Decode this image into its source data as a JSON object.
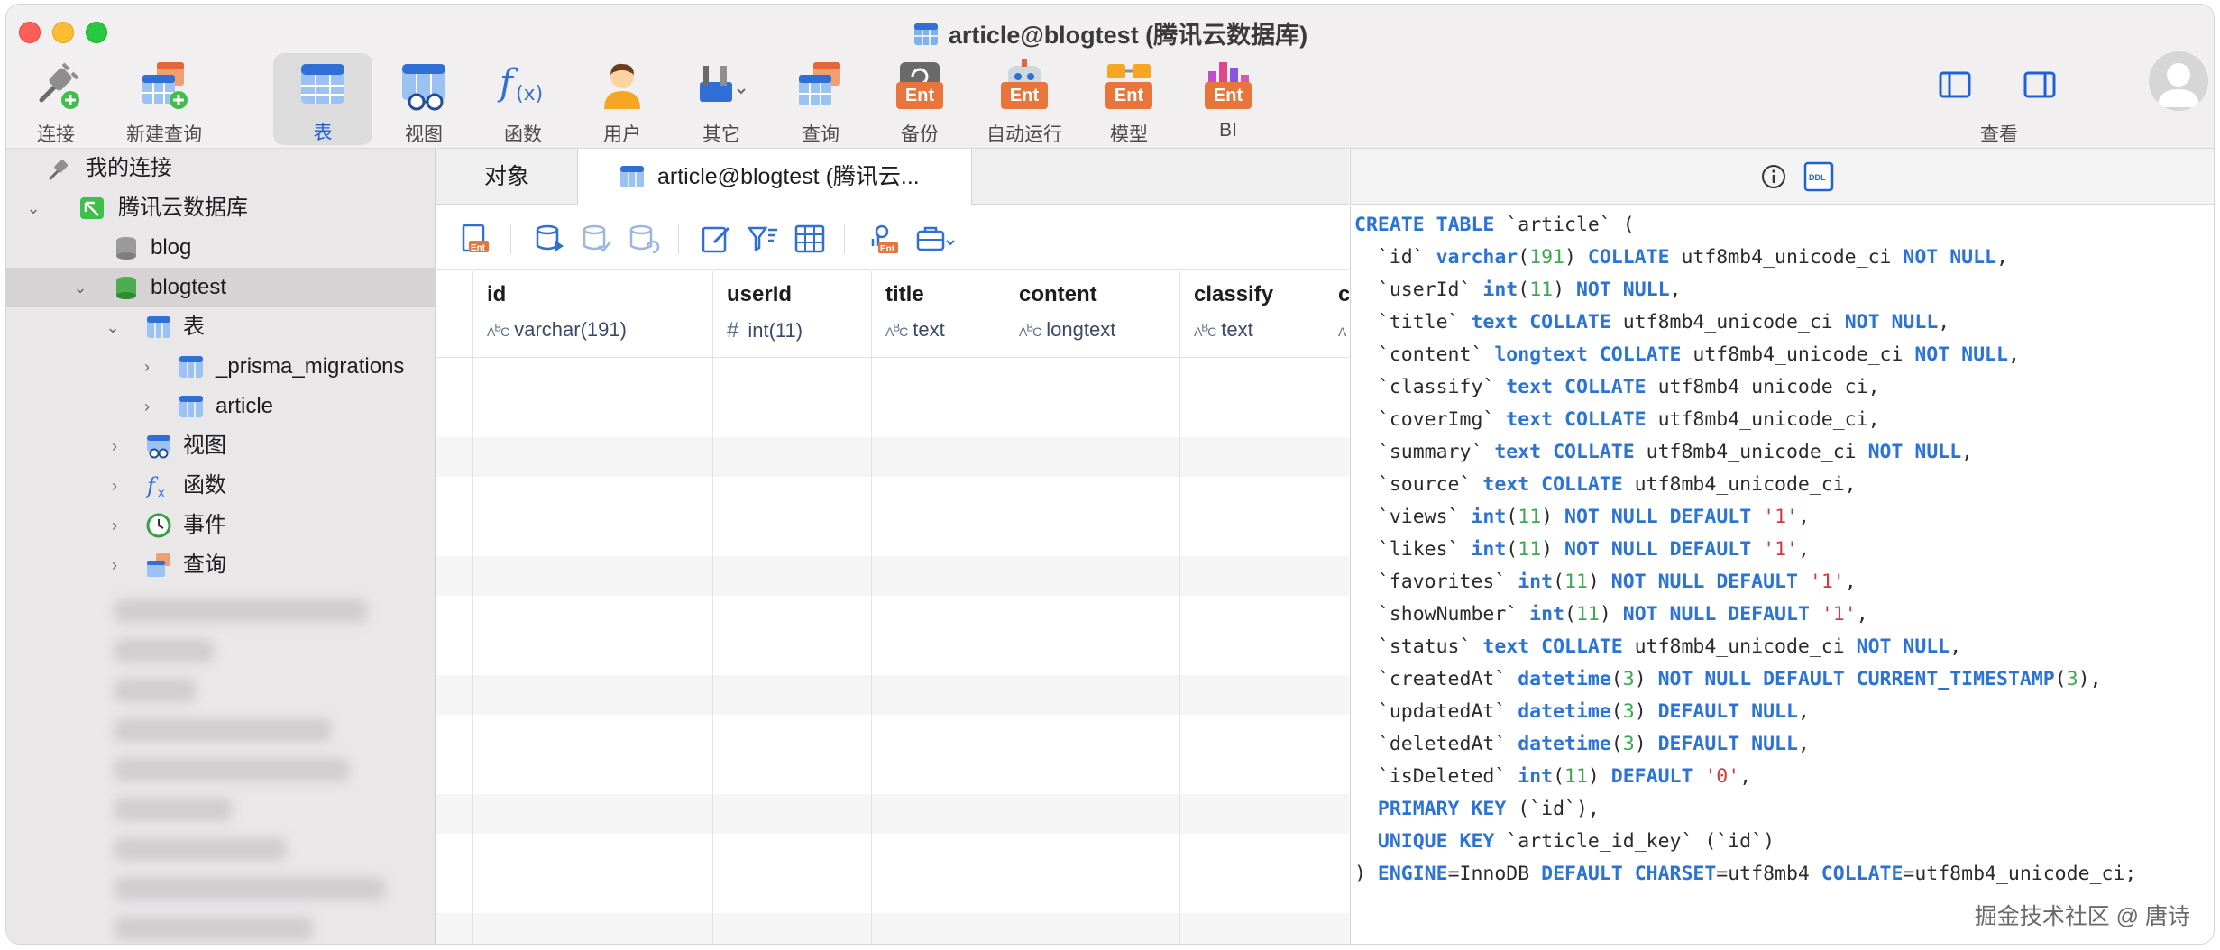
{
  "window": {
    "title": "article@blogtest (腾讯云数据库)"
  },
  "toolbar": {
    "buttons": [
      {
        "label": "连接",
        "icon": "plug-add-icon"
      },
      {
        "label": "新建查询",
        "icon": "new-query-icon"
      },
      {
        "label": "表",
        "icon": "table-icon",
        "active": true
      },
      {
        "label": "视图",
        "icon": "view-icon"
      },
      {
        "label": "函数",
        "icon": "function-icon"
      },
      {
        "label": "用户",
        "icon": "user-icon"
      },
      {
        "label": "其它",
        "icon": "tools-icon"
      },
      {
        "label": "查询",
        "icon": "query-icon"
      },
      {
        "label": "备份",
        "icon": "backup-icon",
        "badge": "Ent"
      },
      {
        "label": "自动运行",
        "icon": "robot-icon",
        "badge": "Ent"
      },
      {
        "label": "模型",
        "icon": "model-icon",
        "badge": "Ent"
      },
      {
        "label": "BI",
        "icon": "bi-icon",
        "badge": "Ent"
      }
    ],
    "view_label": "查看"
  },
  "sidebar": {
    "my_connections": "我的连接",
    "connection": "腾讯云数据库",
    "db_blog": "blog",
    "db_blogtest": "blogtest",
    "tables_group": "表",
    "table_1": "_prisma_migrations",
    "table_2": "article",
    "views": "视图",
    "functions": "函数",
    "events": "事件",
    "queries": "查询"
  },
  "tabs": {
    "objects": "对象",
    "active": "article@blogtest (腾讯云..."
  },
  "grid": {
    "columns": [
      {
        "name": "id",
        "type": "varchar(191)",
        "type_icon": "abc"
      },
      {
        "name": "userId",
        "type": "int(11)",
        "type_icon": "#"
      },
      {
        "name": "title",
        "type": "text",
        "type_icon": "abc"
      },
      {
        "name": "content",
        "type": "longtext",
        "type_icon": "abc"
      },
      {
        "name": "classify",
        "type": "text",
        "type_icon": "abc"
      },
      {
        "name": "c",
        "type": "",
        "type_icon": "abc"
      }
    ]
  },
  "ddl": {
    "lines": [
      "CREATE TABLE `article` (",
      "  `id` varchar(191) COLLATE utf8mb4_unicode_ci NOT NULL,",
      "  `userId` int(11) NOT NULL,",
      "  `title` text COLLATE utf8mb4_unicode_ci NOT NULL,",
      "  `content` longtext COLLATE utf8mb4_unicode_ci NOT NULL,",
      "  `classify` text COLLATE utf8mb4_unicode_ci,",
      "  `coverImg` text COLLATE utf8mb4_unicode_ci,",
      "  `summary` text COLLATE utf8mb4_unicode_ci NOT NULL,",
      "  `source` text COLLATE utf8mb4_unicode_ci,",
      "  `views` int(11) NOT NULL DEFAULT '1',",
      "  `likes` int(11) NOT NULL DEFAULT '1',",
      "  `favorites` int(11) NOT NULL DEFAULT '1',",
      "  `showNumber` int(11) NOT NULL DEFAULT '1',",
      "  `status` text COLLATE utf8mb4_unicode_ci NOT NULL,",
      "  `createdAt` datetime(3) NOT NULL DEFAULT CURRENT_TIMESTAMP(3),",
      "  `updatedAt` datetime(3) DEFAULT NULL,",
      "  `deletedAt` datetime(3) DEFAULT NULL,",
      "  `isDeleted` int(11) DEFAULT '0',",
      "  PRIMARY KEY (`id`),",
      "  UNIQUE KEY `article_id_key` (`id`)",
      ") ENGINE=InnoDB DEFAULT CHARSET=utf8mb4 COLLATE=utf8mb4_unicode_ci;"
    ]
  },
  "watermark": "掘金技术社区 @ 唐诗",
  "colors": {
    "accent": "#1d62d8",
    "keyword": "#2b74d6",
    "number": "#3da94f",
    "string": "#d23b3b",
    "ent_badge": "#e8753b"
  }
}
